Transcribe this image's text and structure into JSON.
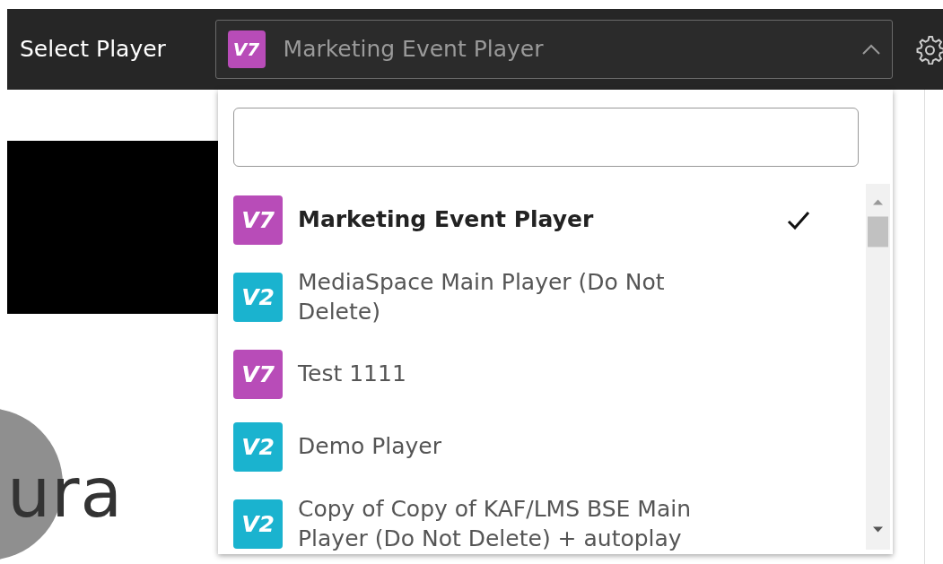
{
  "header": {
    "label": "Select Player",
    "select": {
      "badge": "V7",
      "color": "#b84cb8",
      "value": "Marketing Event Player",
      "expanded": true
    }
  },
  "items": [
    {
      "badge": "V7",
      "color": "#b84cb8",
      "label": "Marketing Event Player",
      "selected": true
    },
    {
      "badge": "V2",
      "color": "#1ab3cf",
      "label": "MediaSpace Main Player (Do Not Delete)",
      "selected": false
    },
    {
      "badge": "V7",
      "color": "#b84cb8",
      "label": "Test 1111",
      "selected": false
    },
    {
      "badge": "V2",
      "color": "#1ab3cf",
      "label": "Demo Player",
      "selected": false
    },
    {
      "badge": "V2",
      "color": "#1ab3cf",
      "label": "Copy of Copy of KAF/LMS BSE Main Player (Do Not Delete) + autoplay",
      "selected": false
    }
  ],
  "logo": {
    "text": "ura"
  }
}
